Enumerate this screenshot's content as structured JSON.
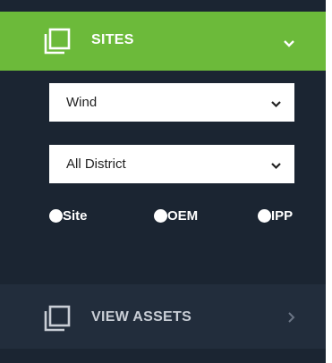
{
  "sidebar": {
    "sites_section": {
      "title": "SITES",
      "icon": "window-squares-icon",
      "expand_icon": "chevron-down-icon",
      "accent_color": "#6cba3a"
    },
    "filters": {
      "type_select": {
        "value": "Wind"
      },
      "district_select": {
        "value": "All District"
      }
    },
    "radio_group": [
      {
        "label": "Site"
      },
      {
        "label": "OEM"
      },
      {
        "label": "IPP"
      }
    ],
    "assets_section": {
      "title": "VIEW ASSETS",
      "icon": "window-squares-icon",
      "expand_icon": "chevron-right-icon"
    }
  },
  "colors": {
    "panel_bg": "#1b2532",
    "assets_bg": "#222d3c"
  }
}
